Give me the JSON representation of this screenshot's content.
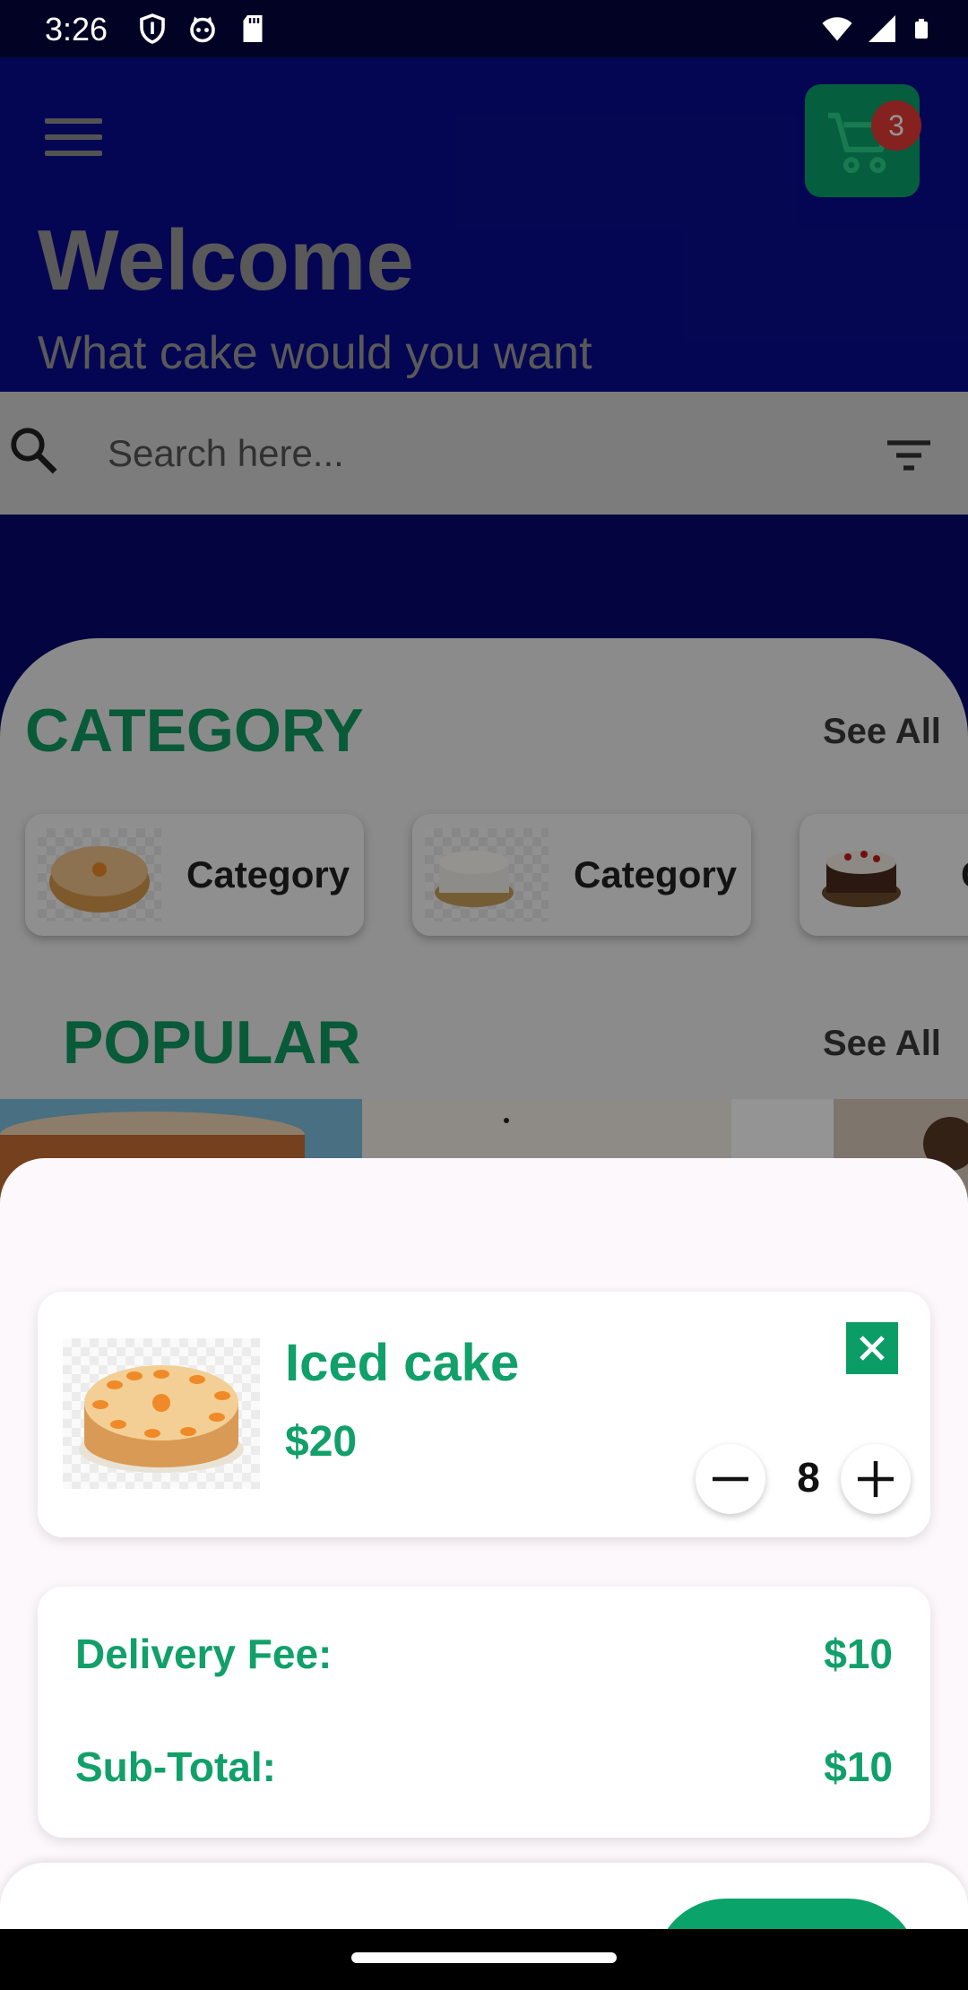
{
  "status_bar": {
    "time": "3:26",
    "icons": [
      "shield-icon",
      "cat-icon",
      "sd-card-icon",
      "wifi-icon",
      "signal-icon",
      "battery-icon"
    ]
  },
  "header": {
    "title": "Welcome",
    "subtitle": "What cake would you want",
    "cart_count": "3"
  },
  "search": {
    "placeholder": "Search here..."
  },
  "category": {
    "title": "CATEGORY",
    "see_all": "See All",
    "items": [
      {
        "label": "Category"
      },
      {
        "label": "Category"
      },
      {
        "label": "C"
      }
    ]
  },
  "popular": {
    "title": "POPULAR",
    "see_all": "See All"
  },
  "cart_sheet": {
    "item": {
      "name": "Iced cake",
      "price": "$20",
      "quantity": "8"
    },
    "summary": {
      "delivery_label": "Delivery Fee:",
      "delivery_value": "$10",
      "subtotal_label": "Sub-Total:",
      "subtotal_value": "$10"
    }
  },
  "colors": {
    "brand_green": "#0aa36a",
    "header_blue": "#0a0c8f",
    "badge_red": "#e53935"
  }
}
